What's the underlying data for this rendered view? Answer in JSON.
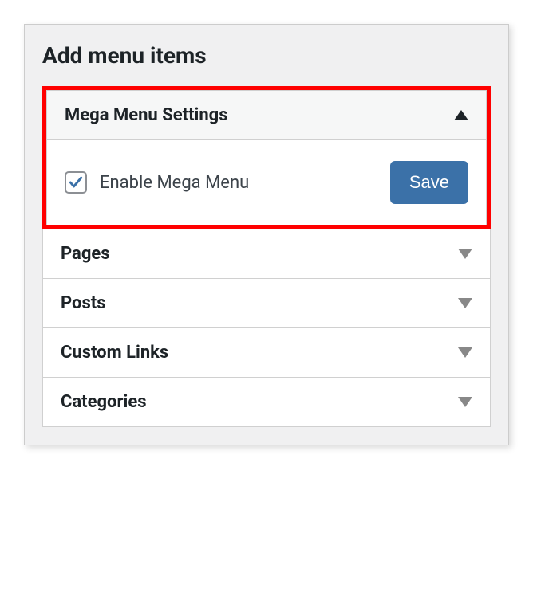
{
  "panel": {
    "title": "Add menu items"
  },
  "megaMenu": {
    "header": "Mega Menu Settings",
    "checkbox_label": "Enable Mega Menu",
    "checkbox_checked": true,
    "save_label": "Save",
    "expanded": true
  },
  "sections": [
    {
      "title": "Pages"
    },
    {
      "title": "Posts"
    },
    {
      "title": "Custom Links"
    },
    {
      "title": "Categories"
    }
  ],
  "colors": {
    "highlight": "#ff0000",
    "primary_button": "#3b71a8",
    "check": "#3b71a8"
  }
}
